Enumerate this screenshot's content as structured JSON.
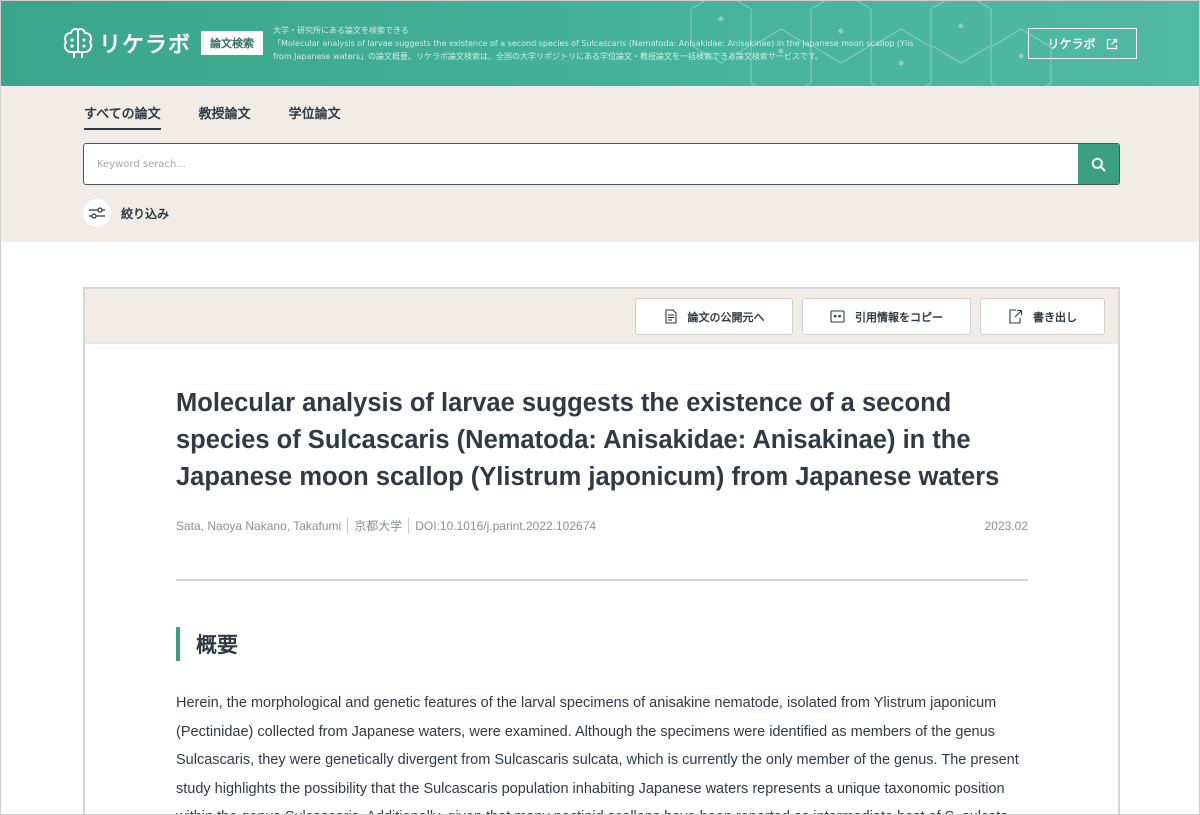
{
  "header": {
    "logo_text": "リケラボ",
    "badge": "論文検索",
    "description_line1": "大学・研究所にある論文を検索できる",
    "description_line2": "「Molecular analysis of larvae suggests the existence of a second species of Sulcascaris (Nematoda: Anisakidae: Anisakinae) in the Japanese moon scallop (Ylistrum japonicum)",
    "description_line3": "from Japanese waters」の論文概要。リケラボ論文検索は、全国の大学リポジトリにある学位論文・教授論文を一括検索できる論文検索サービスです。",
    "link_label": "リケラボ"
  },
  "tabs": [
    {
      "label": "すべての論文",
      "active": true
    },
    {
      "label": "教授論文",
      "active": false
    },
    {
      "label": "学位論文",
      "active": false
    }
  ],
  "search": {
    "placeholder": "Keyword serach...",
    "value": ""
  },
  "filter": {
    "label": "絞り込み"
  },
  "toolbar": {
    "source_label": "論文の公開元へ",
    "cite_label": "引用情報をコピー",
    "export_label": "書き出し"
  },
  "paper": {
    "title": "Molecular analysis of larvae suggests the existence of a second species of Sulcascaris (Nematoda: Anisakidae: Anisakinae) in the Japanese moon scallop (Ylistrum japonicum) from Japanese waters",
    "authors": "Sata, Naoya Nakano, Takafumi",
    "university": "京都大学",
    "doi": "DOI:10.1016/j.parint.2022.102674",
    "date": "2023.02",
    "section_heading": "概要",
    "abstract": "Herein, the morphological and genetic features of the larval specimens of anisakine nematode, isolated from Ylistrum japonicum (Pectinidae) collected from Japanese waters, were examined. Although the specimens were identified as members of the genus Sulcascaris, they were genetically divergent from Sulcascaris sulcata, which is currently the only member of the genus. The present study highlights the possibility that the Sulcascaris population inhabiting Japanese waters represents a unique taxonomic position within the genus Sulcascaris. Additionally, given that many pectinid scallops have been reported as intermediate host of S. sulcata"
  },
  "colors": {
    "brand_green": "#3b9f82",
    "band_beige": "#f1ede6",
    "text_dark": "#2f3a44"
  }
}
